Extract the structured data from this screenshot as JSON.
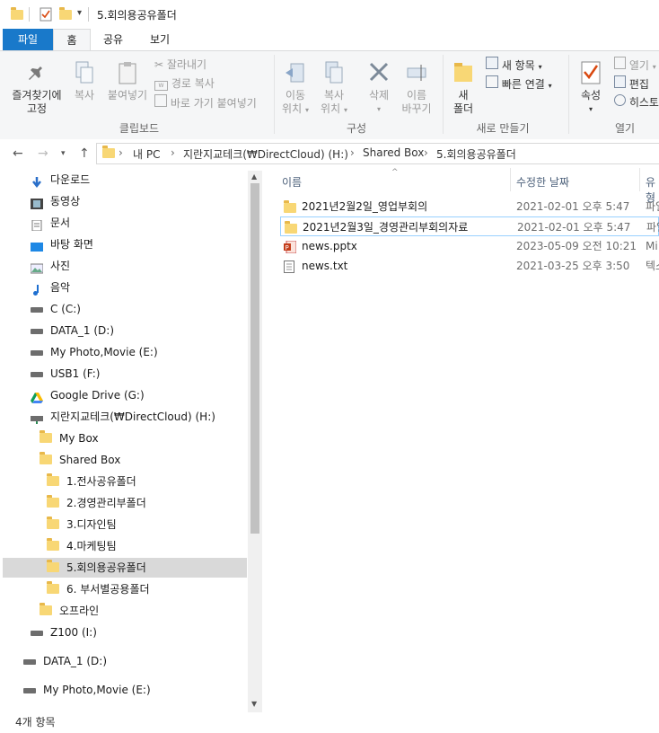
{
  "window": {
    "title": "5.회의용공유폴더"
  },
  "tabs": [
    {
      "label": "파일"
    },
    {
      "label": "홈"
    },
    {
      "label": "공유"
    },
    {
      "label": "보기"
    }
  ],
  "ribbon": {
    "clipboard": {
      "pin_label_line1": "즐겨찾기에",
      "pin_label_line2": "고정",
      "copy_label": "복사",
      "paste_label": "붙여넣기",
      "cut_label": "잘라내기",
      "copy_path_label": "경로 복사",
      "paste_shortcut_label": "바로 가기 붙여넣기",
      "group_label": "클립보드"
    },
    "organize": {
      "move_line1": "이동",
      "move_line2": "위치",
      "copyto_line1": "복사",
      "copyto_line2": "위치",
      "delete_label": "삭제",
      "rename_line1": "이름",
      "rename_line2": "바꾸기",
      "group_label": "구성"
    },
    "new": {
      "new_folder_line1": "새",
      "new_folder_line2": "폴더",
      "new_item_label": "새 항목",
      "easy_access_label": "빠른 연결",
      "group_label": "새로 만들기"
    },
    "open": {
      "properties_label": "속성",
      "open_label": "열기",
      "edit_label": "편집",
      "history_label": "히스토",
      "group_label": "열기"
    }
  },
  "address": {
    "crumbs": [
      "내 PC",
      "지란지교테크(₩DirectCloud) (H:)",
      "Shared Box",
      "5.회의용공유폴더"
    ]
  },
  "nav": {
    "items": [
      {
        "label": "다운로드",
        "icon": "download-icon"
      },
      {
        "label": "동영상",
        "icon": "video-icon"
      },
      {
        "label": "문서",
        "icon": "document-icon"
      },
      {
        "label": "바탕 화면",
        "icon": "desktop-icon"
      },
      {
        "label": "사진",
        "icon": "pictures-icon"
      },
      {
        "label": "음악",
        "icon": "music-icon"
      },
      {
        "label": "C (C:)",
        "icon": "drive-icon"
      },
      {
        "label": "DATA_1 (D:)",
        "icon": "drive-icon"
      },
      {
        "label": "My Photo,Movie (E:)",
        "icon": "drive-icon"
      },
      {
        "label": "USB1 (F:)",
        "icon": "drive-icon"
      },
      {
        "label": "Google Drive (G:)",
        "icon": "google-drive-icon"
      },
      {
        "label": "지란지교테크(₩DirectCloud) (H:)",
        "icon": "network-drive-icon"
      },
      {
        "label": "My Box",
        "icon": "folder-icon"
      },
      {
        "label": "Shared Box",
        "icon": "folder-icon"
      },
      {
        "label": "1.전사공유폴더",
        "icon": "folder-icon"
      },
      {
        "label": "2.경영관리부폴더",
        "icon": "folder-icon"
      },
      {
        "label": "3.디자인팀",
        "icon": "folder-icon"
      },
      {
        "label": "4.마케팅팀",
        "icon": "folder-icon"
      },
      {
        "label": "5.회의용공유폴더",
        "icon": "folder-icon"
      },
      {
        "label": "6. 부서별공용폴더",
        "icon": "folder-icon"
      },
      {
        "label": "오프라인",
        "icon": "folder-icon"
      },
      {
        "label": "Z100 (I:)",
        "icon": "drive-icon"
      },
      {
        "label": "DATA_1 (D:)",
        "icon": "drive-icon"
      },
      {
        "label": "My Photo,Movie (E:)",
        "icon": "drive-icon"
      }
    ]
  },
  "files": {
    "columns": {
      "name": "이름",
      "modified": "수정한 날짜",
      "type": "유형"
    },
    "rows": [
      {
        "name": "2021년2월2일_영업부회의",
        "date": "2021-02-01 오후 5:47",
        "type": "파일",
        "icon": "folder-icon"
      },
      {
        "name": "2021년2월3일_경영관리부회의자료",
        "date": "2021-02-01 오후 5:47",
        "type": "파일",
        "icon": "folder-icon"
      },
      {
        "name": "news.pptx",
        "date": "2023-05-09 오전 10:21",
        "type": "Mi",
        "icon": "powerpoint-file-icon"
      },
      {
        "name": "news.txt",
        "date": "2021-03-25 오후 3:50",
        "type": "텍스",
        "icon": "text-file-icon"
      }
    ]
  },
  "status": {
    "item_count": "4개 항목"
  },
  "colors": {
    "accent": "#1979ca",
    "folder": "#f8d775",
    "selected": "#d9d9d9",
    "hover_border": "#99d1ff"
  }
}
